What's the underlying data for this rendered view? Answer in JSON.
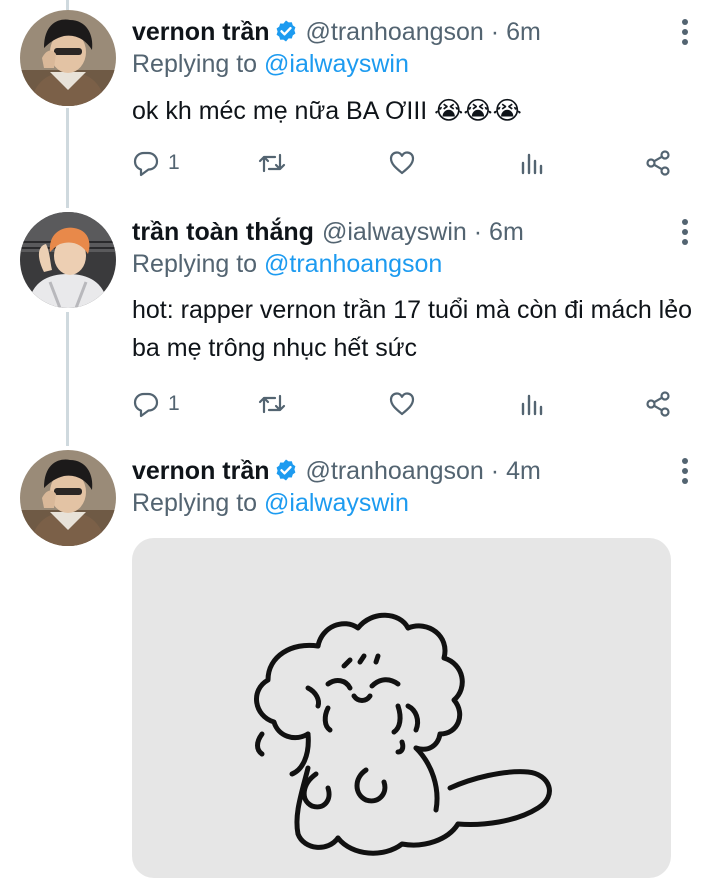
{
  "tweets": [
    {
      "name": "vernon trần",
      "verified": true,
      "handle": "@tranhoangson",
      "separator": "·",
      "time": "6m",
      "replying_prefix": "Replying to",
      "replying_to": "@ialwayswin",
      "text": "ok kh méc mẹ nữa BA ƠIII 😭😭😭",
      "reply_count": "1"
    },
    {
      "name": "trần toàn thắng",
      "verified": false,
      "handle": "@ialwayswin",
      "separator": "·",
      "time": "6m",
      "replying_prefix": "Replying to",
      "replying_to": "@tranhoangson",
      "text": "hot: rapper vernon trần 17 tuổi mà còn đi mách lẻo ba mẹ trông nhục hết sức",
      "reply_count": "1"
    },
    {
      "name": "vernon trần",
      "verified": true,
      "handle": "@tranhoangson",
      "separator": "·",
      "time": "4m",
      "replying_prefix": "Replying to",
      "replying_to": "@ialwayswin",
      "media": "crying-doodle-image"
    }
  ],
  "icons": {
    "reply": "reply-icon",
    "retweet": "retweet-icon",
    "like": "heart-icon",
    "analytics": "analytics-icon",
    "share": "share-icon",
    "more": "more-icon",
    "verified": "verified-badge-icon"
  },
  "colors": {
    "mention": "#1d9bf0",
    "muted": "#536471",
    "verified": "#1d9bf0",
    "thread_line": "#cfd9de",
    "media_bg": "#e6e6e6"
  }
}
